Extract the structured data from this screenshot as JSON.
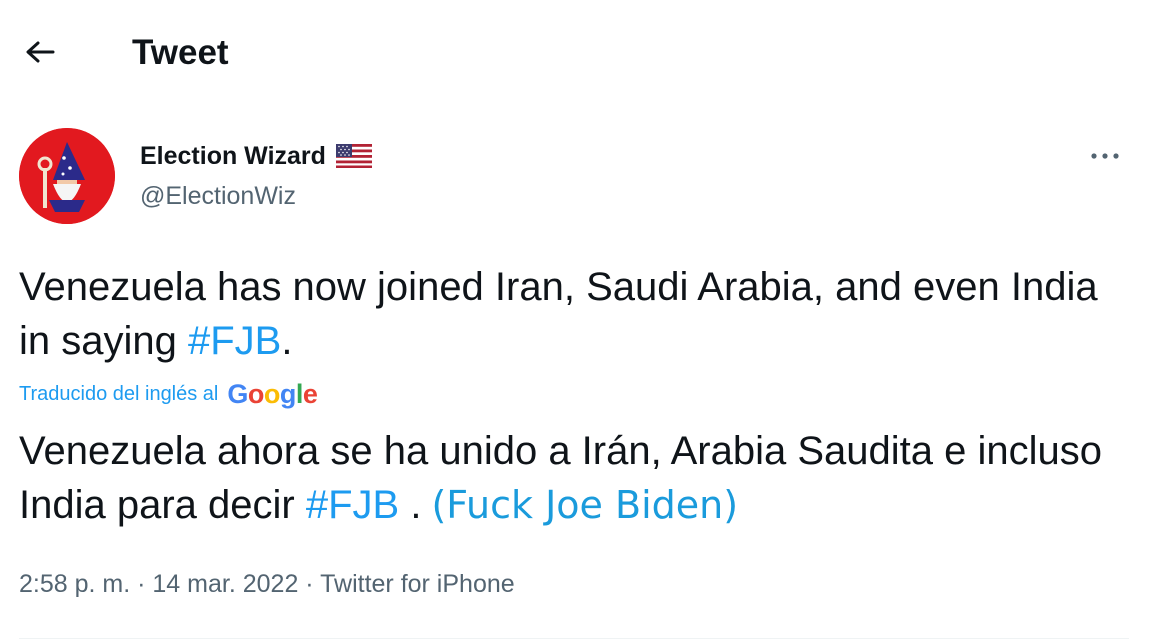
{
  "header": {
    "back_icon": "arrow-left-icon",
    "title": "Tweet"
  },
  "tweet": {
    "author": {
      "display_name": "Election Wizard",
      "flag_icon": "us-flag-icon",
      "handle": "@ElectionWiz"
    },
    "more_icon": "more-horizontal-icon",
    "text_before_hashtag": "Venezuela has now joined Iran, Saudi Arabia, and even India in saying ",
    "hashtag": "#FJB",
    "text_after_hashtag": ".",
    "translation": {
      "label": "Traducido del inglés al",
      "provider": "Google",
      "text_before_hashtag": "Venezuela ahora se ha unido a Irán, Arabia Saudita e incluso India para decir ",
      "hashtag": "#FJB",
      "text_after_hashtag": " .",
      "annotation": "(Fuck Joe Biden)"
    },
    "meta": {
      "time": "2:58 p. m.",
      "separator": "·",
      "date": "14 mar. 2022",
      "source": "Twitter for iPhone"
    }
  },
  "colors": {
    "accent": "#1d9bf0",
    "secondary_text": "#536471",
    "primary_text": "#0f1419",
    "avatar_bg": "#e2191f",
    "annotation": "#1a9bdc"
  }
}
